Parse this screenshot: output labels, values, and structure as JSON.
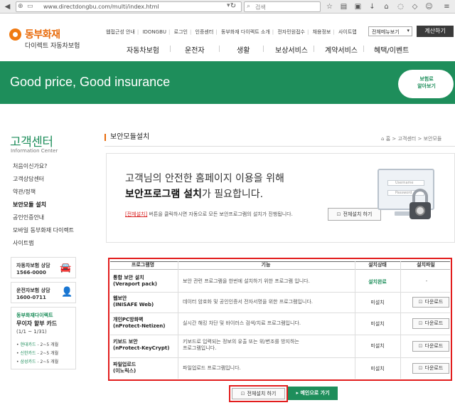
{
  "browser": {
    "url": "www.directdongbu.com/multi/index.html",
    "search_placeholder": "검색"
  },
  "header": {
    "logo_name": "동부화재",
    "logo_sub": "다이렉트 자동차보험",
    "util_links": [
      "웹접근성 안내",
      "IDONGBU",
      "로그인",
      "인증센터",
      "동부화재 다이렉트 소개",
      "전자민원접수",
      "채용정보",
      "사이트맵"
    ],
    "shortcut_select": "전체메뉴보기",
    "calc_button": "계산하기",
    "gnb": [
      "자동차보험",
      "운전자",
      "생활",
      "보상서비스",
      "계약서비스",
      "혜택/이벤트"
    ]
  },
  "banner": {
    "text": "Good price, Good insurance",
    "cloud_line1": "보험료",
    "cloud_line2": "알아보기"
  },
  "lnb": {
    "title": "고객센터",
    "subtitle": "Information Center",
    "items": [
      "처음이신가요?",
      "고객상담센터",
      "약관/정책",
      "보안모듈 설치",
      "공인인증안내",
      "모바일 동부화재 다이렉트",
      "사이트맵"
    ],
    "active_index": 3,
    "box1": {
      "title": "자동차보험 상담",
      "phone": "1566-0000"
    },
    "box2": {
      "title": "운전자보험 상담",
      "phone": "1600-0711"
    },
    "card": {
      "title": "동부화재다이렉트",
      "line2": "무이자 할부 카드",
      "line3": "(1/1 ~ 1/31)",
      "items": [
        {
          "card": "현대카드",
          "term": "2~5 개월"
        },
        {
          "card": "신한카드",
          "term": "2~5 개월"
        },
        {
          "card": "삼성카드",
          "term": "2~5 개월"
        }
      ]
    }
  },
  "content": {
    "page_title": "보안모듈설치",
    "breadcrumb": [
      "홈",
      "고객센터",
      "보안모듈"
    ],
    "notice_line1": "고객님의 안전한 홈페이지 이용을 위해",
    "notice_line2_bold": "보안프로그램 설치",
    "notice_line2_rest": "가 필요합니다.",
    "hint_link": "[전체설치]",
    "hint_rest": " 버튼을 클릭하시면 자동으로 모든 보안프로그램의 설치가 진행됩니다.",
    "install_all_label": "전체설치 하기",
    "monitor_user": "Username",
    "monitor_pass": "Password"
  },
  "table": {
    "headers": [
      "프로그램명",
      "기능",
      "설치상태",
      "설치파일"
    ],
    "rows": [
      {
        "name1": "통합 보안 설치",
        "name2": "(Veraport pack)",
        "desc1": "보안 관련 프로그램을 한번에 설치하기 위한 프로그램 입니다.",
        "desc2": "",
        "status": "설치완료",
        "file": "-"
      },
      {
        "name1": "웹보안",
        "name2": "(INISAFE Web)",
        "desc1": "데이터 암호화 및 공인인증서 전자서명을 위한 프로그램입니다.",
        "desc2": "",
        "status": "미설치",
        "file": "다운로드"
      },
      {
        "name1": "개인PC방화벽",
        "name2": "(nProtect-Netizen)",
        "desc1": "실시간 해킹 차단 및 바이러스 검색/치료 프로그램입니다.",
        "desc2": "",
        "status": "미설치",
        "file": "다운로드"
      },
      {
        "name1": "키보드 보안",
        "name2": "(nProtect-KeyCrypt)",
        "desc1": "키보드로 입력되는 정보의 유출 또는 위/변조를 방지하는",
        "desc2": "프로그램입니다.",
        "status": "미설치",
        "file": "다운로드"
      },
      {
        "name1": "파일업로드",
        "name2": "(이노릭스)",
        "desc1": "파일업로드 프로그램입니다.",
        "desc2": "",
        "status": "미설치",
        "file": "다운로드"
      }
    ]
  },
  "bottom": {
    "install_all_label": "전체설치 하기",
    "main_label": "메인으로 가기"
  }
}
